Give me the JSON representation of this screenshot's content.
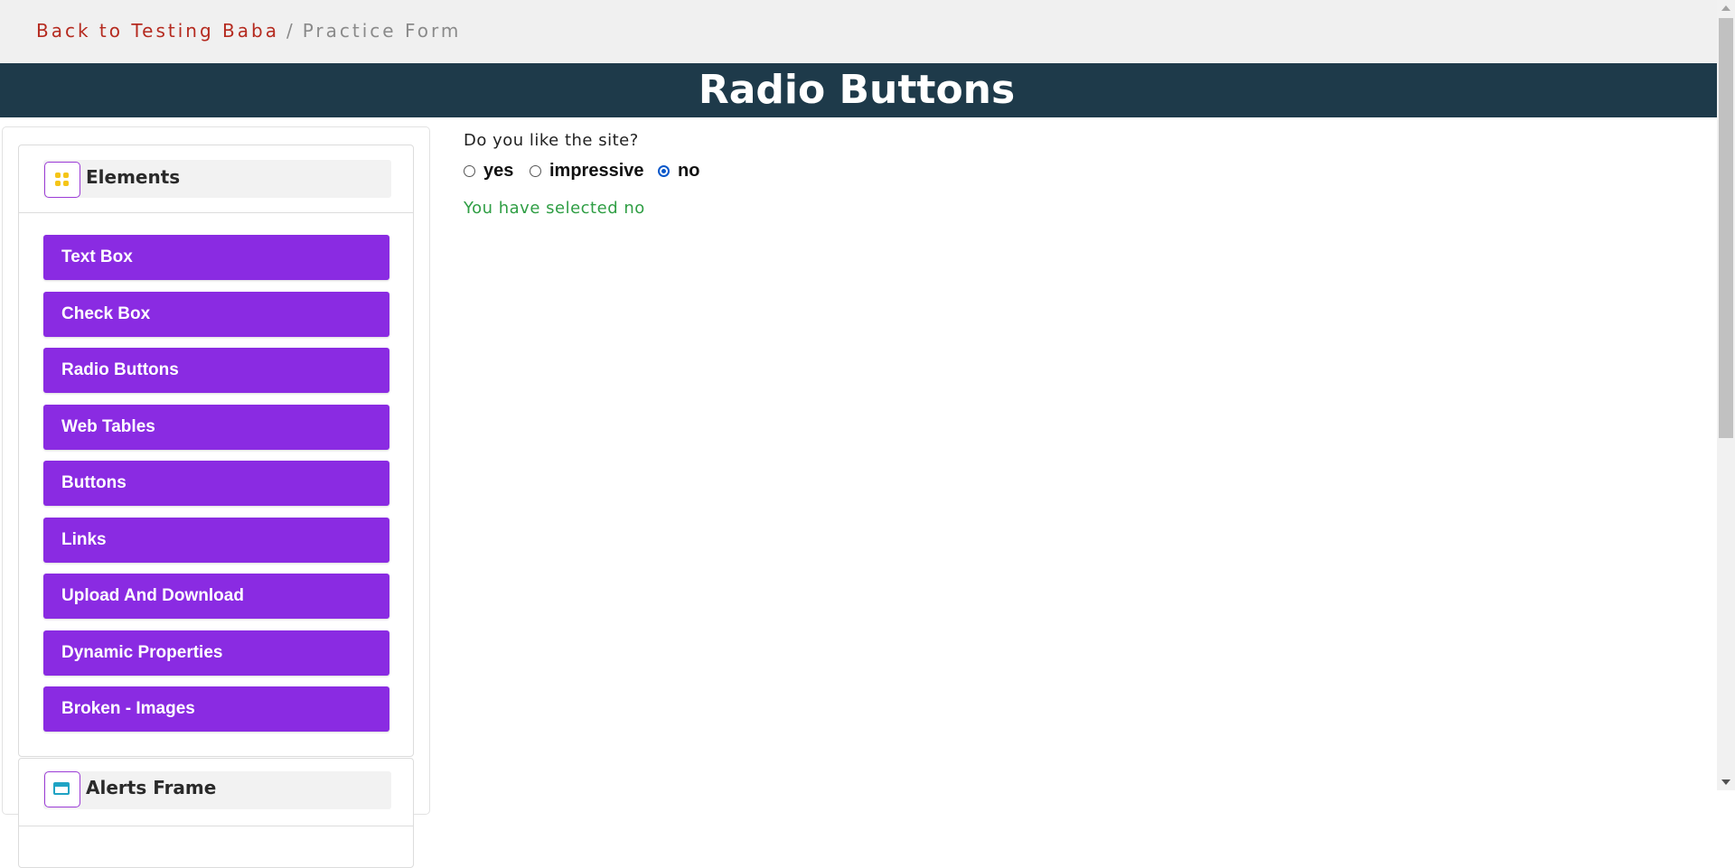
{
  "breadcrumb": {
    "link": "Back to Testing Baba",
    "separator": "/",
    "current": "Practice Form"
  },
  "header": {
    "title": "Radio Buttons"
  },
  "sidebar": {
    "groups": [
      {
        "title": "Elements",
        "icon": "grid-icon",
        "items": [
          {
            "label": "Text Box"
          },
          {
            "label": "Check Box"
          },
          {
            "label": "Radio Buttons"
          },
          {
            "label": "Web Tables"
          },
          {
            "label": "Buttons"
          },
          {
            "label": "Links"
          },
          {
            "label": "Upload And Download"
          },
          {
            "label": "Dynamic Properties"
          },
          {
            "label": "Broken - Images"
          }
        ]
      },
      {
        "title": "Alerts Frame",
        "icon": "window-icon"
      }
    ]
  },
  "main": {
    "question": "Do you like the site?",
    "options": [
      {
        "label": "yes",
        "checked": false
      },
      {
        "label": "impressive",
        "checked": false
      },
      {
        "label": "no",
        "checked": true
      }
    ],
    "result": "You have selected no"
  },
  "colors": {
    "header_bg": "#1e3a4a",
    "button_bg": "#8a2be2",
    "breadcrumb_link": "#b52a1f",
    "result_text": "#2f9e44",
    "radio_checked": "#0a58ca"
  }
}
